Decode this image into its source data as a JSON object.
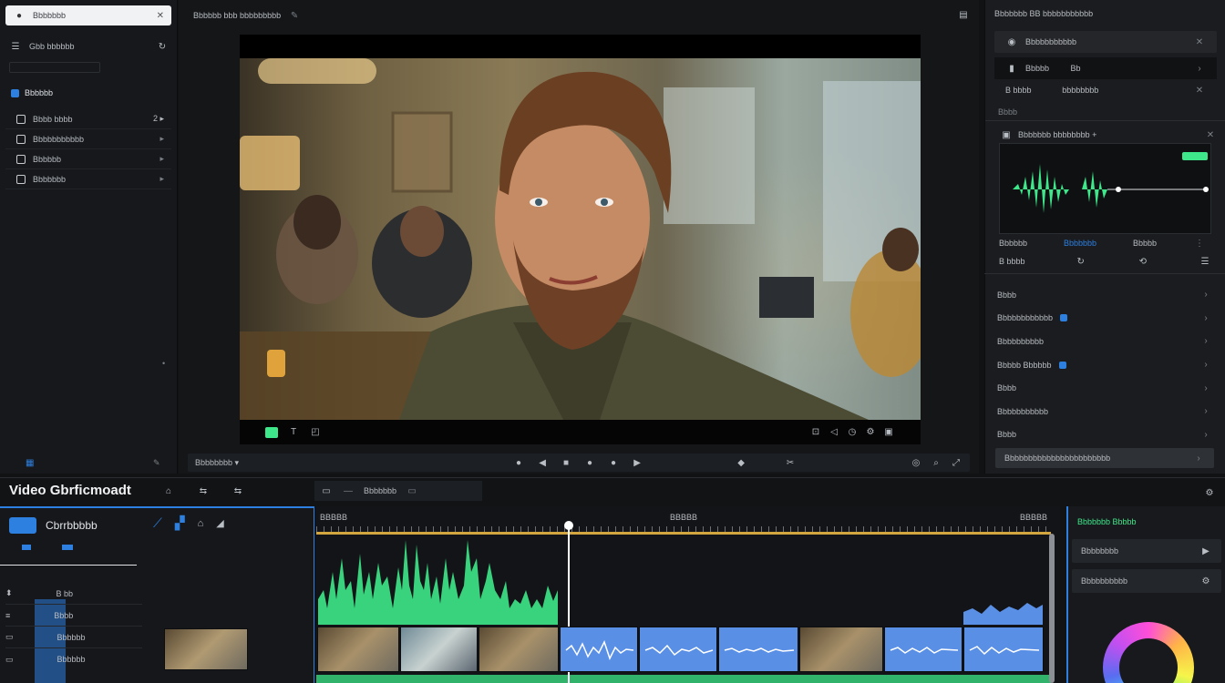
{
  "left_sidebar": {
    "search_text": "Bbbbbbb",
    "header_label": "Gbb bbbbbb",
    "section_label": "Bbbbbb",
    "items": [
      {
        "label": "Bbbb bbbb",
        "suffix": "2 ▸"
      },
      {
        "label": "Bbbbbbbbbbb",
        "suffix": "▸"
      },
      {
        "label": "Bbbbbb",
        "suffix": "▸"
      },
      {
        "label": "Bbbbbbb",
        "suffix": "▸"
      }
    ]
  },
  "center": {
    "title": "Bbbbbb bbb bbbbbbbbb",
    "subbar_label": "Bbbbbbbb ▾"
  },
  "right_panel": {
    "title": "Bbbbbbb BB  bbbbbbbbbbb",
    "effect_label": "Bbbbbbbbbbb",
    "row1_label": "Bbbbb",
    "row1_value": "Bb",
    "row2_label": "B bbbb",
    "row2_value": "bbbbbbbb",
    "section1": "Bbbb",
    "audio_label": "Bbbbbbb bbbbbbbb +",
    "audio_badge": "",
    "tabs": [
      "Bbbbbb",
      "Bbbbbbb",
      "Bbbbb"
    ],
    "tool_label": "B bbbb",
    "list": [
      {
        "label": "Bbbb",
        "dot": false
      },
      {
        "label": "Bbbbbbbbbbbb",
        "dot": true
      },
      {
        "label": "Bbbbbbbbbb",
        "dot": false
      },
      {
        "label": "Bbbbb Bbbbbb",
        "dot": true
      },
      {
        "label": "Bbbb",
        "dot": false
      },
      {
        "label": "Bbbbbbbbbbb",
        "dot": false
      },
      {
        "label": "Bbbb",
        "dot": false
      }
    ],
    "footer_button": "Bbbbbbbbbbbbbbbbbbbbbbb"
  },
  "bottom": {
    "app_title": "Video Gbrficmoadt",
    "tab_label": "Bbbbbbb",
    "left_label": "Cbrrbbbbb",
    "track_labels": [
      "B bb",
      "Bbbb",
      "Bbbbbb",
      "Bbbbbb"
    ],
    "ruler": [
      "BBBBB",
      "BBBBB",
      "BBBBB"
    ],
    "right_section": "Bbbbbbb Bbbbb",
    "right_items": [
      "Bbbbbbbb",
      "Bbbbbbbbbb"
    ]
  },
  "colors": {
    "accent": "#2d7fe0",
    "wave_green": "#3ee88a",
    "audio_clip": "#5a8fe6",
    "playhead": "#ffffff",
    "timeline_gold": "#d4a640"
  },
  "icons": [
    "search-icon",
    "menu-icon",
    "grid-icon",
    "chevron-right-icon",
    "play-icon",
    "scissors-icon",
    "settings-icon",
    "color-wheel-icon"
  ]
}
